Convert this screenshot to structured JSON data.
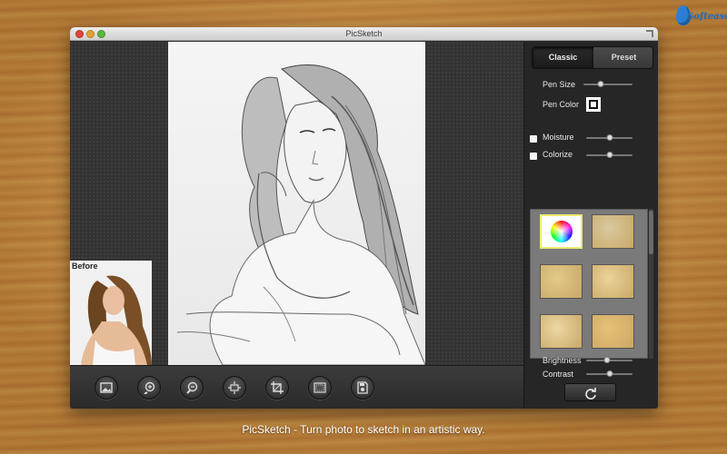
{
  "window": {
    "title": "PicSketch"
  },
  "logo": {
    "text": "Softease"
  },
  "before": {
    "label": "Before"
  },
  "tabs": [
    {
      "label": "Classic",
      "active": true
    },
    {
      "label": "Preset",
      "active": false
    }
  ],
  "controls": {
    "pen_size": {
      "label": "Pen Size",
      "value": 0.35
    },
    "pen_color": {
      "label": "Pen Color",
      "color": "#ffffff"
    },
    "moisture": {
      "label": "Moisture",
      "checked": false,
      "value": 0.5
    },
    "colorize": {
      "label": "Colorize",
      "checked": false,
      "value": 0.5
    },
    "brightness": {
      "label": "Brightness",
      "value": 0.45
    },
    "contrast": {
      "label": "Contrast",
      "value": 0.5
    }
  },
  "toolbar": {
    "buttons": [
      {
        "icon": "open-image-icon"
      },
      {
        "icon": "zoom-in-icon"
      },
      {
        "icon": "zoom-out-icon"
      },
      {
        "icon": "fit-to-window-icon"
      },
      {
        "icon": "crop-icon"
      },
      {
        "icon": "frame-icon"
      },
      {
        "icon": "save-icon"
      }
    ]
  },
  "textures": [
    {
      "name": "color-wheel",
      "color": "#ffffff",
      "selected": true
    },
    {
      "name": "texture-1",
      "color": "#d8c9a0",
      "selected": false
    },
    {
      "name": "texture-2",
      "color": "#e2c98a",
      "selected": false
    },
    {
      "name": "texture-3",
      "color": "#ecd29a",
      "selected": false
    },
    {
      "name": "texture-4",
      "color": "#ecd7a4",
      "selected": false
    },
    {
      "name": "texture-5",
      "color": "#e8c078",
      "selected": false
    }
  ],
  "caption": "PicSketch - Turn photo to sketch in an artistic way."
}
